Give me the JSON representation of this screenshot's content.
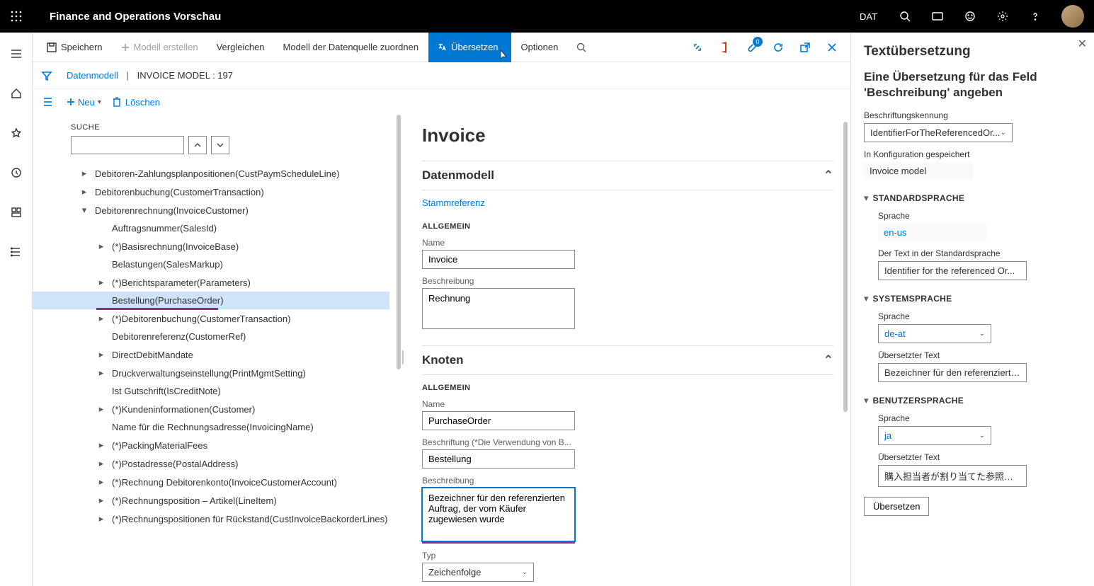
{
  "titlebar": {
    "app": "Finance and Operations Vorschau",
    "env": "DAT"
  },
  "cmdbar": {
    "save": "Speichern",
    "model": "Modell erstellen",
    "compare": "Vergleichen",
    "map": "Modell der Datenquelle zuordnen",
    "translate": "Übersetzen",
    "options": "Optionen",
    "badge": "0"
  },
  "breadcrumb": {
    "root": "Datenmodell",
    "current": "INVOICE MODEL : 197"
  },
  "neurow": {
    "neu": "Neu",
    "loeschen": "Löschen"
  },
  "suche": "SUCHE",
  "tree": [
    {
      "label": "Debitoren-Zahlungsplanpositionen(CustPaymScheduleLine)",
      "caret": true,
      "indent": 1
    },
    {
      "label": "Debitorenbuchung(CustomerTransaction)",
      "caret": true,
      "indent": 1
    },
    {
      "label": "Debitorenrechnung(InvoiceCustomer)",
      "caret": true,
      "indent": 1,
      "open": true
    },
    {
      "label": "Auftragsnummer(SalesId)",
      "caret": false,
      "indent": 2
    },
    {
      "label": "(*)Basisrechnung(InvoiceBase)",
      "caret": true,
      "indent": 2
    },
    {
      "label": "Belastungen(SalesMarkup)",
      "caret": false,
      "indent": 2
    },
    {
      "label": "(*)Berichtsparameter(Parameters)",
      "caret": true,
      "indent": 2
    },
    {
      "label": "Bestellung(PurchaseOrder)",
      "caret": false,
      "indent": 2,
      "selected": true
    },
    {
      "label": "(*)Debitorenbuchung(CustomerTransaction)",
      "caret": true,
      "indent": 2
    },
    {
      "label": "Debitorenreferenz(CustomerRef)",
      "caret": false,
      "indent": 2
    },
    {
      "label": "DirectDebitMandate",
      "caret": true,
      "indent": 2
    },
    {
      "label": "Druckverwaltungseinstellung(PrintMgmtSetting)",
      "caret": true,
      "indent": 2
    },
    {
      "label": "Ist Gutschrift(IsCreditNote)",
      "caret": false,
      "indent": 2
    },
    {
      "label": "(*)Kundeninformationen(Customer)",
      "caret": true,
      "indent": 2
    },
    {
      "label": "Name für die Rechnungsadresse(InvoicingName)",
      "caret": false,
      "indent": 2
    },
    {
      "label": "(*)PackingMaterialFees",
      "caret": true,
      "indent": 2
    },
    {
      "label": "(*)Postadresse(PostalAddress)",
      "caret": true,
      "indent": 2
    },
    {
      "label": "(*)Rechnung Debitorenkonto(InvoiceCustomerAccount)",
      "caret": true,
      "indent": 2
    },
    {
      "label": "(*)Rechnungsposition – Artikel(LineItem)",
      "caret": true,
      "indent": 2
    },
    {
      "label": "(*)Rechnungspositionen für Rückstand(CustInvoiceBackorderLines)",
      "caret": true,
      "indent": 2
    }
  ],
  "detail": {
    "title": "Invoice",
    "sec1": "Datenmodell",
    "stamm": "Stammreferenz",
    "allg": "ALLGEMEIN",
    "nameLabel": "Name",
    "nameVal": "Invoice",
    "beschLabel": "Beschreibung",
    "beschVal": "Rechnung",
    "sec2": "Knoten",
    "knNameLabel": "Name",
    "knNameVal": "PurchaseOrder",
    "knBeschriftLabel": "Beschriftung (*Die Verwendung von B...",
    "knBeschriftVal": "Bestellung",
    "knBeschLabel": "Beschreibung",
    "knBeschVal": "Bezeichner für den referenzierten Auftrag, der vom Käufer zugewiesen wurde",
    "typLabel": "Typ",
    "typVal": "Zeichenfolge"
  },
  "rightPane": {
    "title": "Textübersetzung",
    "sub": "Eine Übersetzung für das Feld 'Beschreibung' angeben",
    "labKennung": "Beschriftungskennung",
    "kennungVal": "IdentifierForTheReferencedOr...",
    "konfigLabel": "In Konfiguration gespeichert",
    "konfigVal": "Invoice model",
    "stdSprache": "STANDARDSPRACHE",
    "sprache": "Sprache",
    "stdLang": "en-us",
    "stdTextLabel": "Der Text in der Standardsprache",
    "stdTextVal": "Identifier for the referenced Or...",
    "sysSprache": "SYSTEMSPRACHE",
    "sysLang": "de-at",
    "uebText": "Übersetzter Text",
    "sysTextVal": "Bezeichner für den referenzierte...",
    "benSprache": "BENUTZERSPRACHE",
    "benLang": "ja",
    "benTextVal": "購入担当者が割り当てた参照オ...",
    "btn": "Übersetzen"
  }
}
